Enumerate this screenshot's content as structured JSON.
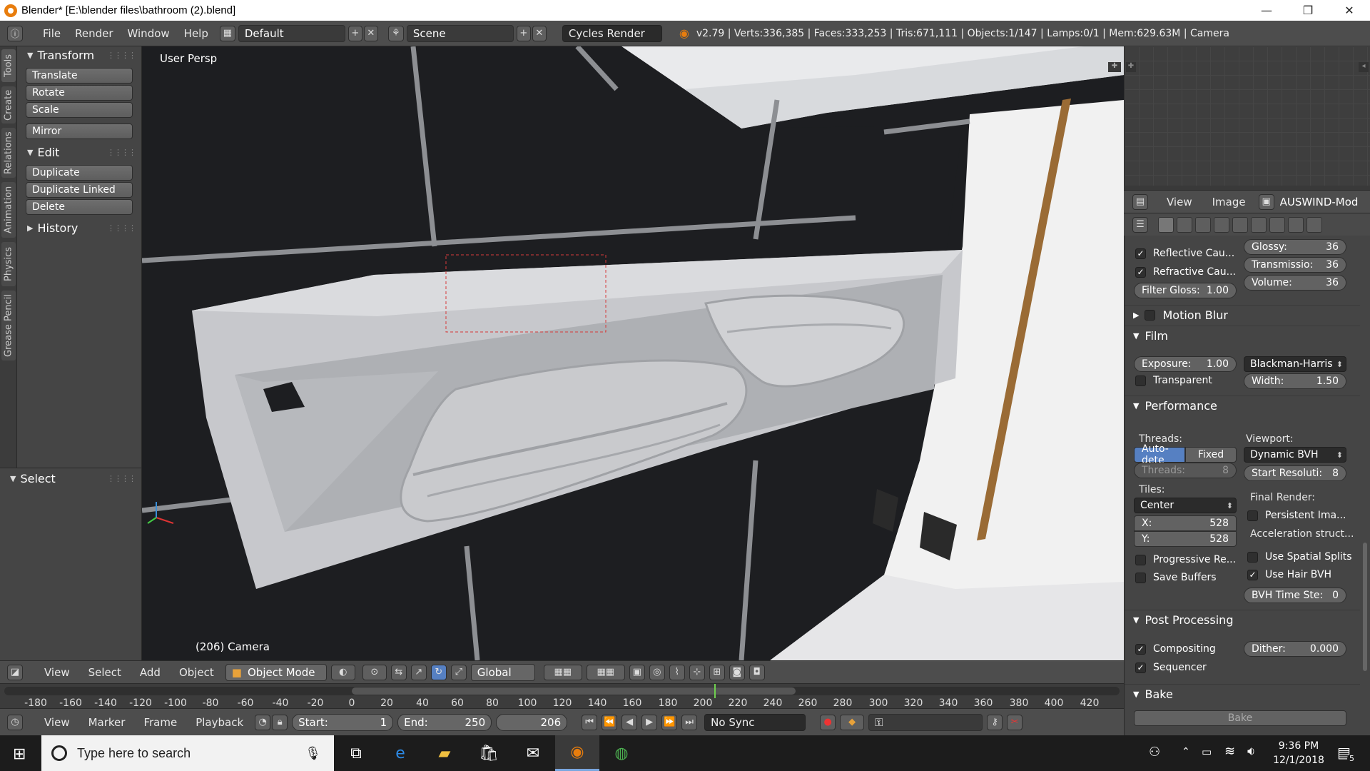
{
  "window": {
    "title": "Blender* [E:\\blender files\\bathroom (2).blend]",
    "controls": [
      "—",
      "❐",
      "✕"
    ]
  },
  "topbar": {
    "menus": [
      "File",
      "Render",
      "Window",
      "Help"
    ],
    "screen_layout": "Default",
    "scene": "Scene",
    "engine": "Cycles Render",
    "stats": "v2.79 | Verts:336,385 | Faces:333,253 | Tris:671,111 | Objects:1/147 | Lamps:0/1 | Mem:629.63M | Camera"
  },
  "toolshelf": {
    "tabs": [
      "Tools",
      "Create",
      "Relations",
      "Animation",
      "Physics",
      "Grease Pencil"
    ],
    "transform_header": "Transform",
    "transform_buttons": [
      "Translate",
      "Rotate",
      "Scale"
    ],
    "mirror": "Mirror",
    "edit_header": "Edit",
    "edit_buttons": [
      "Duplicate",
      "Duplicate Linked",
      "Delete"
    ],
    "history_header": "History",
    "select_header": "Select"
  },
  "viewport": {
    "perspective_label": "User Persp",
    "object_label": "(206) Camera"
  },
  "view_header": {
    "menus": [
      "View",
      "Select",
      "Add",
      "Object"
    ],
    "mode": "Object Mode",
    "orientation": "Global"
  },
  "timeline": {
    "ruler_ticks": [
      "-180",
      "-160",
      "-140",
      "-120",
      "-100",
      "-80",
      "-60",
      "-40",
      "-20",
      "0",
      "20",
      "40",
      "60",
      "80",
      "100",
      "120",
      "140",
      "160",
      "180",
      "200",
      "220",
      "240",
      "260",
      "280",
      "300",
      "320",
      "340",
      "360",
      "380",
      "400",
      "420"
    ],
    "menus": [
      "View",
      "Marker",
      "Frame",
      "Playback"
    ],
    "start_label": "Start:",
    "start_value": "1",
    "end_label": "End:",
    "end_value": "250",
    "current_frame": "206",
    "sync": "No Sync"
  },
  "image_editor": {
    "menus": [
      "View",
      "Image"
    ],
    "image_name": "AUSWIND-Modern"
  },
  "properties": {
    "reflective": "Reflective Cau...",
    "refractive": "Refractive Cau...",
    "filter_gloss": {
      "label": "Filter Gloss:",
      "value": "1.00"
    },
    "glossy": {
      "label": "Glossy:",
      "value": "36"
    },
    "transmission": {
      "label": "Transmissio:",
      "value": "36"
    },
    "volume": {
      "label": "Volume:",
      "value": "36"
    },
    "motion_blur": "Motion Blur",
    "film": "Film",
    "exposure": {
      "label": "Exposure:",
      "value": "1.00"
    },
    "filter_type": "Blackman-Harris",
    "transparent": "Transparent",
    "width": {
      "label": "Width:",
      "value": "1.50"
    },
    "performance": "Performance",
    "threads_label": "Threads:",
    "threads_auto": "Auto-dete",
    "threads_fixed": "Fixed",
    "threads_count": {
      "label": "Threads:",
      "value": "8"
    },
    "viewport_label": "Viewport:",
    "viewport_bvh": "Dynamic BVH",
    "start_resolution": {
      "label": "Start Resoluti:",
      "value": "8"
    },
    "tiles_label": "Tiles:",
    "tiles_order": "Center",
    "tile_x": {
      "label": "X:",
      "value": "528"
    },
    "tile_y": {
      "label": "Y:",
      "value": "528"
    },
    "final_render": "Final Render:",
    "persistent": "Persistent Ima...",
    "accel": "Acceleration struct...",
    "spatial_splits": "Use Spatial Splits",
    "hair_bvh": "Use Hair BVH",
    "bvh_time": {
      "label": "BVH Time Ste:",
      "value": "0"
    },
    "progressive": "Progressive Re...",
    "save_buffers": "Save Buffers",
    "post_processing": "Post Processing",
    "compositing": "Compositing",
    "sequencer": "Sequencer",
    "dither": {
      "label": "Dither:",
      "value": "0.000"
    },
    "bake": "Bake",
    "bake_button": "Bake"
  },
  "taskbar": {
    "search_placeholder": "Type here to search",
    "time": "9:36 PM",
    "date": "12/1/2018",
    "notifications": "5"
  }
}
